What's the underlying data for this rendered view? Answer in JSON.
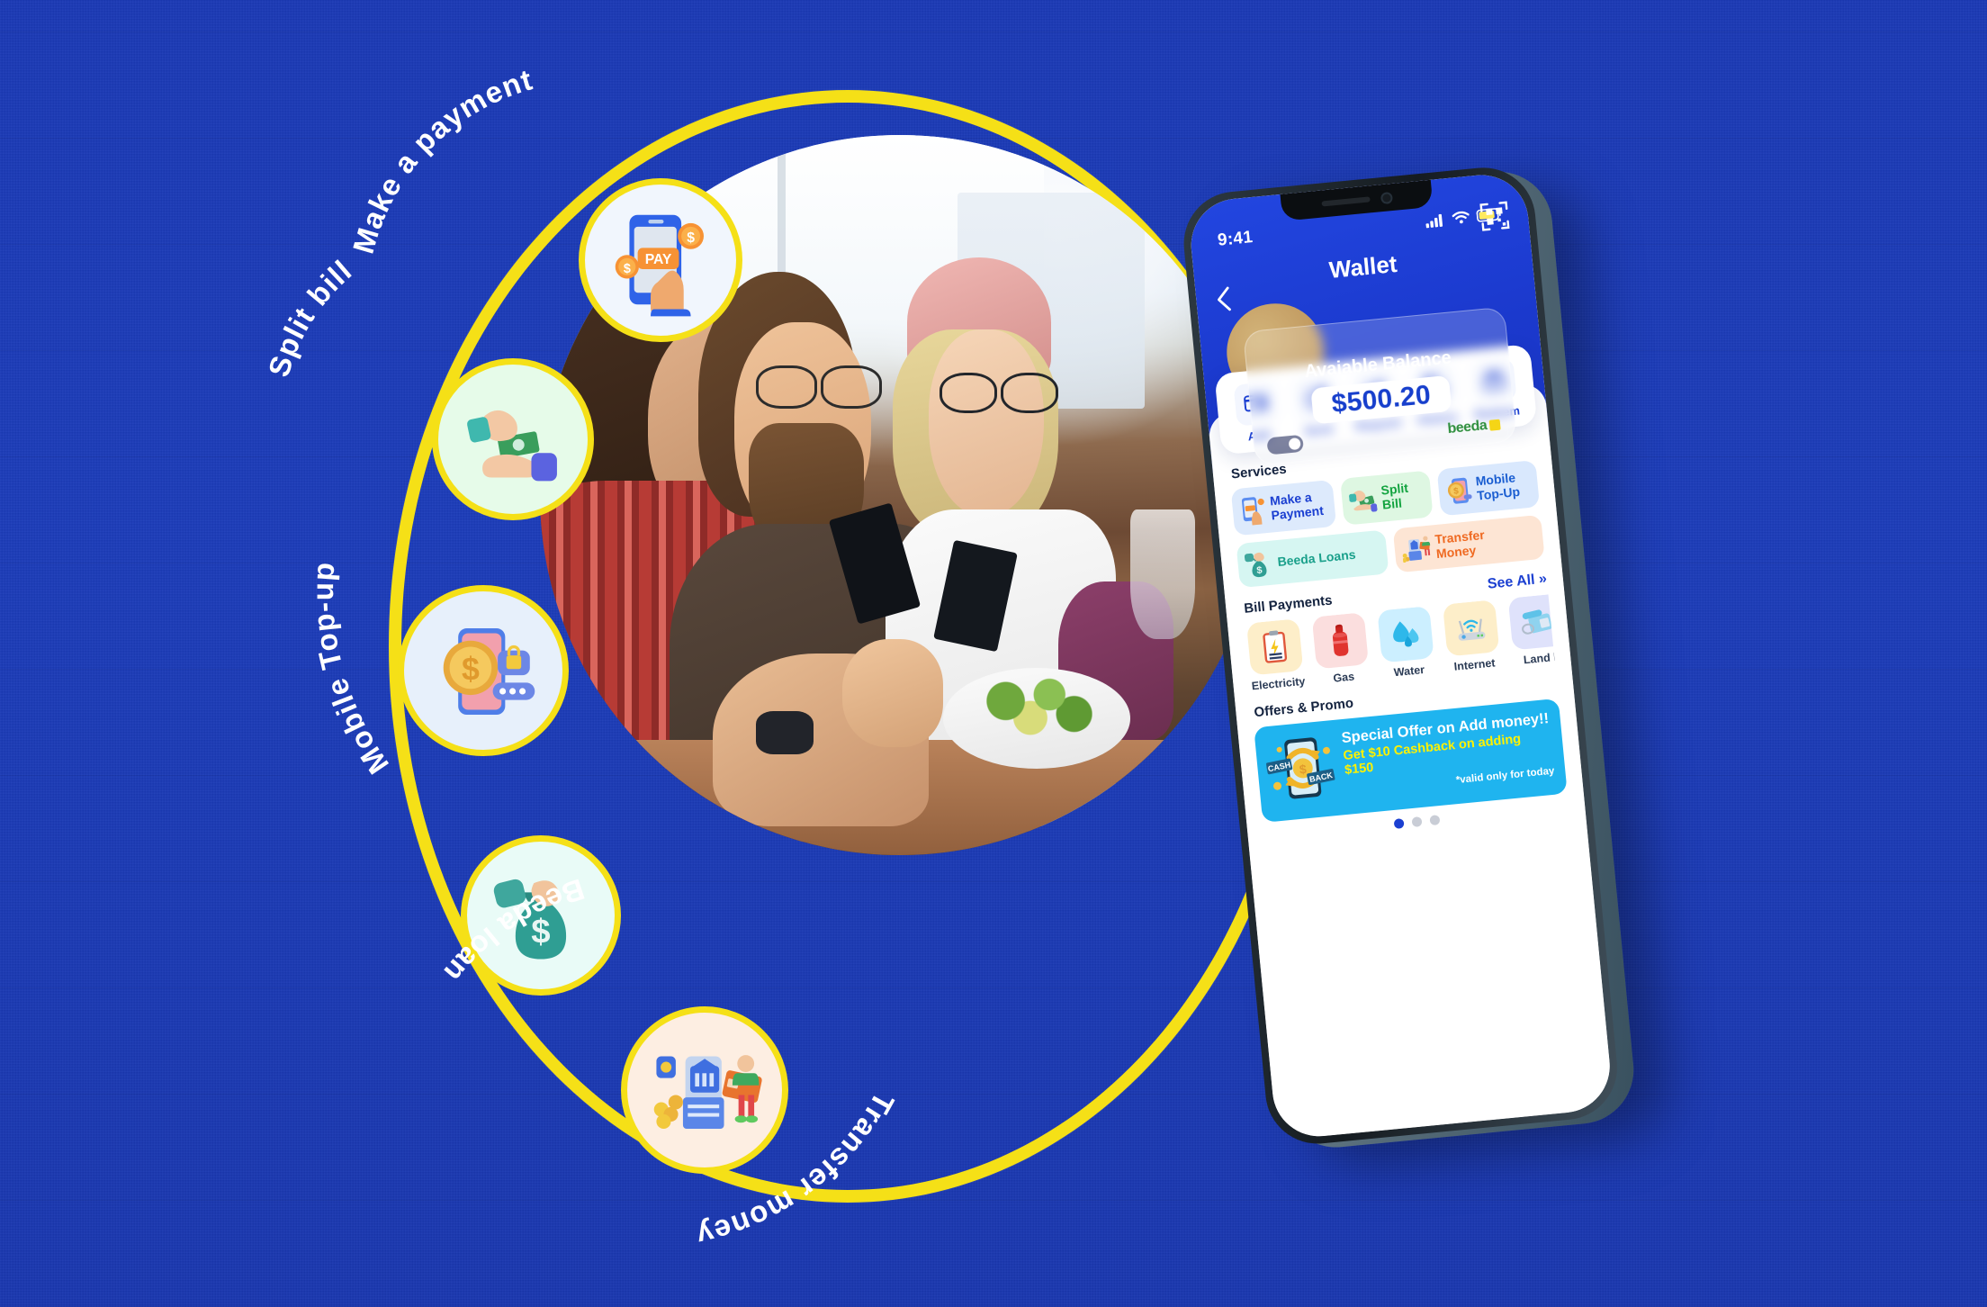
{
  "theme": {
    "bg_blue": "#1c3bb5",
    "ring_yellow": "#f5e017",
    "app_blue": "#1b3fd1",
    "accent_green": "#12a33f",
    "accent_orange": "#ef6a22",
    "accent_teal": "#1aa08b",
    "offer_cyan": "#1fb4ef",
    "offer_yellow": "#fff200"
  },
  "orbit_labels": [
    {
      "id": "make-a-payment",
      "text": "Make a payment"
    },
    {
      "id": "split-bill",
      "text": "Split bill"
    },
    {
      "id": "mobile-top-up",
      "text": "Mobile Top-up"
    },
    {
      "id": "beeda-loan",
      "text": "Beeda loan"
    },
    {
      "id": "transfer-money",
      "text": "Transfer money"
    }
  ],
  "orbit_icons": [
    {
      "id": "make-a-payment-icon",
      "name": "phone-pay-hand-icon"
    },
    {
      "id": "split-bill-icon",
      "name": "hands-exchanging-cash-icon"
    },
    {
      "id": "mobile-top-up-icon",
      "name": "phone-coin-lock-icon"
    },
    {
      "id": "beeda-loan-icon",
      "name": "hand-money-bag-icon"
    },
    {
      "id": "transfer-money-icon",
      "name": "bank-atm-person-card-icon"
    }
  ],
  "phone": {
    "status": {
      "time": "9:41",
      "signal_icon": "cellular-bars-icon",
      "wifi_icon": "wifi-icon",
      "battery_icon": "battery-icon"
    },
    "nav": {
      "back_icon": "chevron-left-icon",
      "title": "Wallet",
      "qr_icon": "qr-code-icon"
    },
    "balance_card": {
      "label": "Avaiable Balance",
      "amount": "$500.20",
      "brand": "beeda",
      "toggle_icon": "toggle-switch-icon"
    },
    "quick_actions": [
      {
        "label": "Add",
        "icon": "card-add-icon"
      },
      {
        "label": "Send",
        "icon": "dollar-arrow-out-icon"
      },
      {
        "label": "Request",
        "icon": "dollar-arrow-in-icon"
      },
      {
        "label": "History",
        "icon": "receipt-clock-icon"
      },
      {
        "label": "Redeem",
        "icon": "gift-icon"
      }
    ],
    "services": {
      "title": "Services",
      "items": [
        {
          "label": "Make a\nPayment",
          "label_line1": "Make a",
          "label_line2": "Payment",
          "icon": "phone-pay-hand-icon"
        },
        {
          "label": "Split\nBill",
          "label_line1": "Split",
          "label_line2": "Bill",
          "icon": "hands-cash-icon"
        },
        {
          "label": "Mobile\nTop-Up",
          "label_line1": "Mobile",
          "label_line2": "Top-Up",
          "icon": "phone-coin-icon"
        },
        {
          "label": "Beeda Loans",
          "label_line1": "Beeda Loans",
          "label_line2": "",
          "icon": "money-bag-icon"
        },
        {
          "label": "Transfer\nMoney",
          "label_line1": "Transfer",
          "label_line2": "Money",
          "icon": "bank-transfer-icon"
        }
      ]
    },
    "bill_payments": {
      "title": "Bill Payments",
      "see_all": "See All »",
      "items": [
        {
          "label": "Electricity",
          "icon": "clipboard-bolt-icon"
        },
        {
          "label": "Gas",
          "icon": "gas-cylinder-icon"
        },
        {
          "label": "Water",
          "icon": "water-drops-icon"
        },
        {
          "label": "Internet",
          "icon": "wifi-router-icon"
        },
        {
          "label": "Land l",
          "icon": "landline-phone-icon"
        }
      ]
    },
    "offers": {
      "title": "Offers & Promo",
      "banner": {
        "art_icon": "cashback-phone-icon",
        "art_text": "CASH BACK",
        "headline": "Special Offer on  Add money!!",
        "subline": "Get $10 Cashback on adding $150",
        "footnote": "*valid only for today"
      },
      "dots": {
        "count": 3,
        "active_index": 0
      }
    },
    "home_indicator": "home-indicator-bar"
  }
}
